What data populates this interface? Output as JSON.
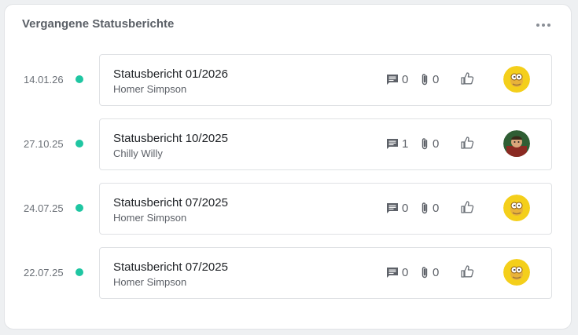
{
  "widget": {
    "title": "Vergangene Statusberichte",
    "menu_icon": "more-horizontal-icon"
  },
  "colors": {
    "dot": "#1fc6a2",
    "avatar_homer_bg": "#f4cf1b",
    "avatar_chilly_bg": "#3a6b3a"
  },
  "reports": [
    {
      "date": "14.01.26",
      "title": "Statusbericht 01/2026",
      "author": "Homer Simpson",
      "comments": "0",
      "attachments": "0",
      "avatar": "homer-avatar-icon"
    },
    {
      "date": "27.10.25",
      "title": "Statusbericht 10/2025",
      "author": "Chilly Willy",
      "comments": "1",
      "attachments": "0",
      "avatar": "chilly-avatar-icon"
    },
    {
      "date": "24.07.25",
      "title": "Statusbericht 07/2025",
      "author": "Homer Simpson",
      "comments": "0",
      "attachments": "0",
      "avatar": "homer-avatar-icon"
    },
    {
      "date": "22.07.25",
      "title": "Statusbericht 07/2025",
      "author": "Homer Simpson",
      "comments": "0",
      "attachments": "0",
      "avatar": "homer-avatar-icon"
    }
  ]
}
